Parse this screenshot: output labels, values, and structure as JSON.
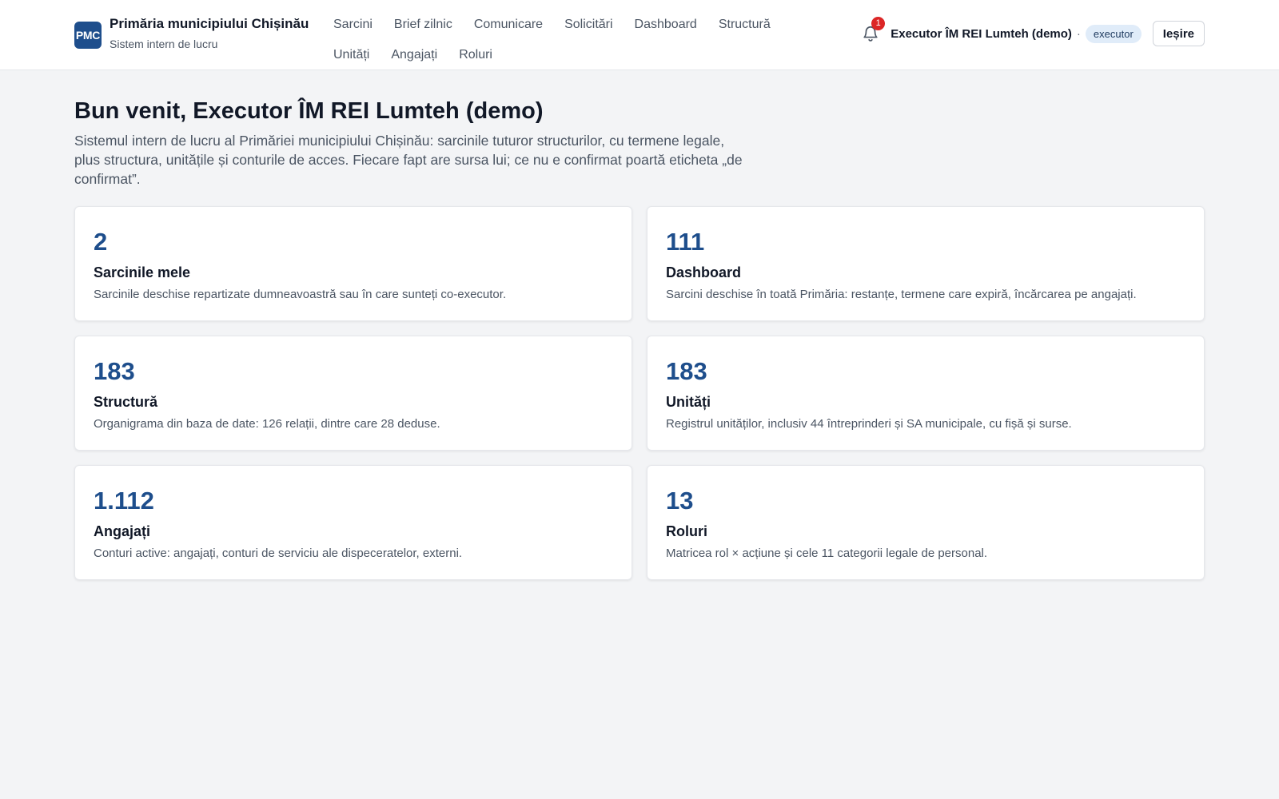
{
  "brand": {
    "logo_text": "PMC",
    "title": "Primăria municipiului Chișinău",
    "subtitle": "Sistem intern de lucru"
  },
  "nav": {
    "row1": [
      "Sarcini",
      "Brief zilnic",
      "Comunicare",
      "Solicitări",
      "Dashboard",
      "Structură"
    ],
    "row2": [
      "Unități",
      "Angajați",
      "Roluri"
    ]
  },
  "user": {
    "notifications_count": "1",
    "name": "Executor ÎM REI Lumteh (demo)",
    "separator": "·",
    "role": "executor",
    "logout_label": "Ieșire"
  },
  "main": {
    "title": "Bun venit, Executor ÎM REI Lumteh (demo)",
    "intro": "Sistemul intern de lucru al Primăriei municipiului Chișinău: sarcinile tuturor structurilor, cu termene legale, plus structura, unitățile și conturile de acces. Fiecare fapt are sursa lui; ce nu e confirmat poartă eticheta „de confirmat”.",
    "cards": [
      {
        "value": "2",
        "title": "Sarcinile mele",
        "desc": "Sarcinile deschise repartizate dumneavoastră sau în care sunteți co-executor."
      },
      {
        "value": "111",
        "title": "Dashboard",
        "desc": "Sarcini deschise în toată Primăria: restanțe, termene care expiră, încărcarea pe angajați."
      },
      {
        "value": "183",
        "title": "Structură",
        "desc": "Organigrama din baza de date: 126 relații, dintre care 28 deduse."
      },
      {
        "value": "183",
        "title": "Unități",
        "desc": "Registrul unităților, inclusiv 44 întreprinderi și SA municipale, cu fișă și surse."
      },
      {
        "value": "1.112",
        "title": "Angajați",
        "desc": "Conturi active: angajați, conturi de serviciu ale dispeceratelor, externi."
      },
      {
        "value": "13",
        "title": "Roluri",
        "desc": "Matricea rol × acțiune și cele 11 categorii legale de personal."
      }
    ]
  },
  "colors": {
    "accent": "#1e4e8c",
    "badge_bg": "#e0ecf9",
    "notification": "#dc2626",
    "page_bg": "#f3f4f6"
  },
  "icons": {
    "notifications": "bell-icon"
  }
}
